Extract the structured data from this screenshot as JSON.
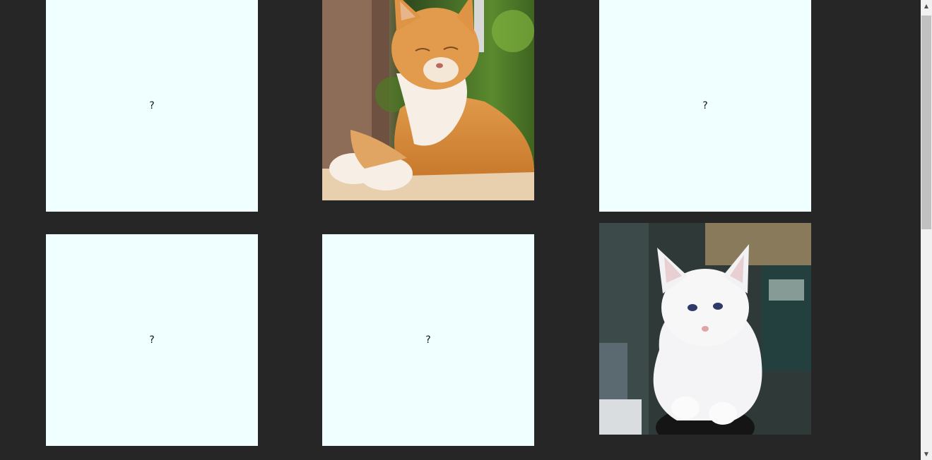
{
  "board": {
    "cards": [
      {
        "state": "hidden",
        "label": "?"
      },
      {
        "state": "revealed",
        "image": "orange-tabby-cat"
      },
      {
        "state": "hidden",
        "label": "?"
      },
      {
        "state": "hidden",
        "label": "?"
      },
      {
        "state": "hidden",
        "label": "?"
      },
      {
        "state": "revealed",
        "image": "white-cat"
      }
    ]
  },
  "colors": {
    "background": "#262626",
    "card_back": "#f0ffff",
    "scrollbar_track": "#f1f1f1",
    "scrollbar_thumb": "#c1c1c1"
  },
  "scrollbar": {
    "up_icon": "arrow-up-icon",
    "down_icon": "arrow-down-icon"
  }
}
